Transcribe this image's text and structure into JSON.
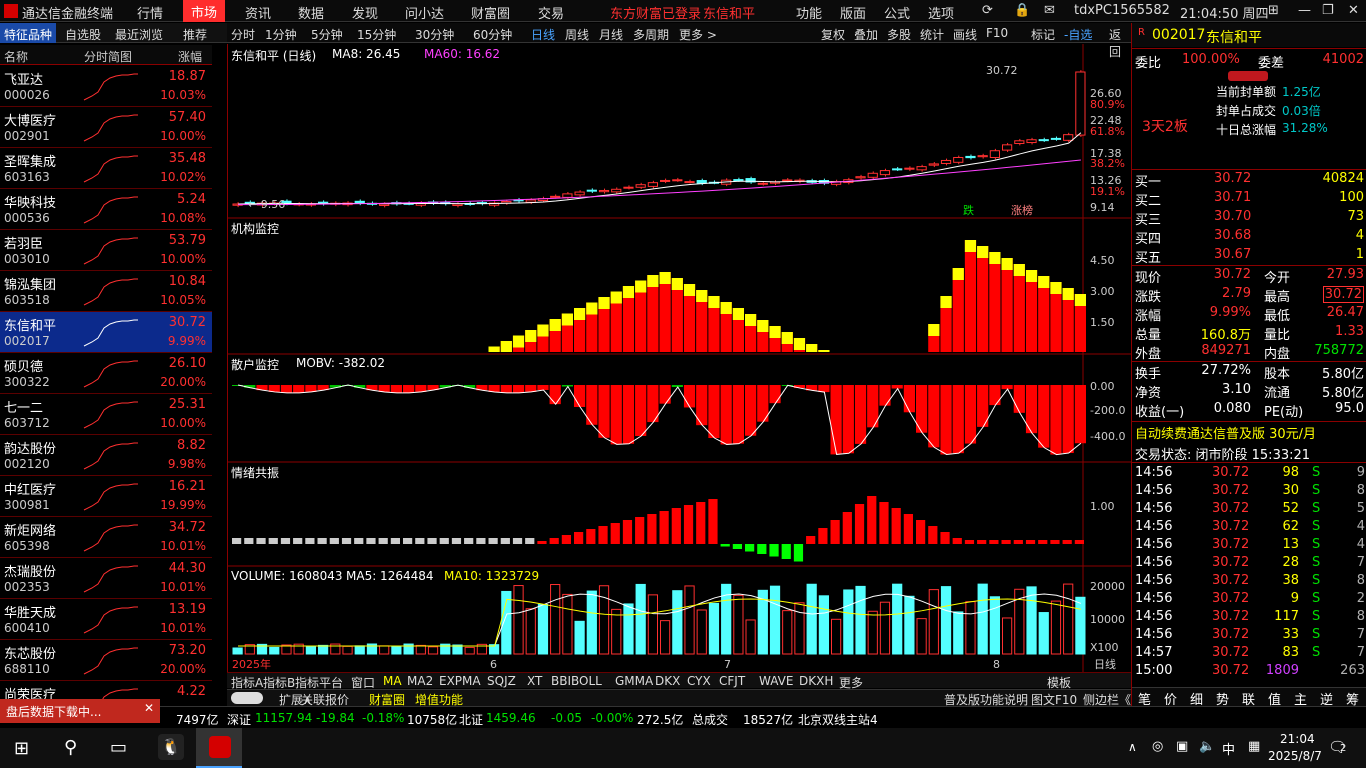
{
  "app": {
    "title": "通达信金融终端",
    "connection_notice": "东方财富已登录",
    "stock_notice": "东信和平",
    "pc_id": "tdxPC1565582",
    "clock": "21:04:50 周四"
  },
  "menu": [
    "行情",
    "市场",
    "资讯",
    "数据",
    "发现",
    "问小达",
    "财富圈",
    "交易"
  ],
  "menu_active": "市场",
  "menu_right": [
    "功能",
    "版面",
    "公式",
    "选项"
  ],
  "left_tabs": [
    "特征品种",
    "自选股",
    "最近浏览",
    "推荐"
  ],
  "list_headers": {
    "name": "名称",
    "chart": "分时简图",
    "change": "涨幅"
  },
  "stocks": [
    {
      "name": "飞亚达",
      "code": "000026",
      "price": "18.87",
      "pct": "10.03%"
    },
    {
      "name": "大博医疗",
      "code": "002901",
      "price": "57.40",
      "pct": "10.00%"
    },
    {
      "name": "圣晖集成",
      "code": "603163",
      "price": "35.48",
      "pct": "10.02%"
    },
    {
      "name": "华映科技",
      "code": "000536",
      "price": "5.24",
      "pct": "10.08%"
    },
    {
      "name": "若羽臣",
      "code": "003010",
      "price": "53.79",
      "pct": "10.00%"
    },
    {
      "name": "锦泓集团",
      "code": "603518",
      "price": "10.84",
      "pct": "10.05%"
    },
    {
      "name": "东信和平",
      "code": "002017",
      "price": "30.72",
      "pct": "9.99%"
    },
    {
      "name": "硕贝德",
      "code": "300322",
      "price": "26.10",
      "pct": "20.00%"
    },
    {
      "name": "七一二",
      "code": "603712",
      "price": "25.31",
      "pct": "10.00%"
    },
    {
      "name": "韵达股份",
      "code": "002120",
      "price": "8.82",
      "pct": "9.98%"
    },
    {
      "name": "中红医疗",
      "code": "300981",
      "price": "16.21",
      "pct": "19.99%"
    },
    {
      "name": "新炬网络",
      "code": "605398",
      "price": "34.72",
      "pct": "10.01%"
    },
    {
      "name": "杰瑞股份",
      "code": "002353",
      "price": "44.30",
      "pct": "10.01%"
    },
    {
      "name": "华胜天成",
      "code": "600410",
      "price": "13.19",
      "pct": "10.01%"
    },
    {
      "name": "东芯股份",
      "code": "688110",
      "price": "73.20",
      "pct": "20.00%"
    },
    {
      "name": "尚荣医疗",
      "code": "",
      "price": "4.22",
      "pct": ""
    }
  ],
  "chart_toolbar": [
    "分时",
    "1分钟",
    "5分钟",
    "15分钟",
    "30分钟",
    "60分钟",
    "日线",
    "周线",
    "月线",
    "多周期",
    "更多 >"
  ],
  "chart_toolbar_active": "日线",
  "chart_toolbar_right": [
    "复权",
    "叠加",
    "多股",
    "统计",
    "画线",
    "F10",
    "标记",
    "-自选",
    "返回"
  ],
  "panels": {
    "k": {
      "title": "东信和平 (日线)",
      "ma8": "MA8: 26.45",
      "ma60": "MA60: 16.62",
      "high_label": "30.72",
      "low_label": "9.56",
      "axis": [
        "26.60",
        "80.9%",
        "22.48",
        "61.8%",
        "17.38",
        "38.2%",
        "13.26",
        "19.1%",
        "9.14"
      ],
      "marks": [
        "跌",
        "涨榜"
      ]
    },
    "inst": {
      "title": "机构监控",
      "axis": [
        "4.50",
        "3.00",
        "1.50"
      ]
    },
    "retail": {
      "title": "散户监控",
      "value": "MOBV: -382.02",
      "axis": [
        "0.00",
        "-200.0",
        "-400.0"
      ]
    },
    "mood": {
      "title": "情绪共振",
      "axis": [
        "1.00"
      ]
    },
    "vol": {
      "title": "VOLUME: 1608043",
      "ma5": "MA5: 1264484",
      "ma10": "MA10: 1323729",
      "axis": [
        "20000",
        "10000",
        "X100"
      ]
    }
  },
  "time_axis": [
    "2025年",
    "6",
    "7",
    "8",
    "日线"
  ],
  "bottom_tabs": [
    "指标A",
    "指标B",
    "指标平台",
    "窗口",
    "MA",
    "MA2",
    "EXPMA",
    "SQJZ",
    "XT",
    "BBIBOLL",
    "GMMA",
    "DKX",
    "CYX",
    "CFJT",
    "WAVE",
    "DKXH",
    "更多",
    "模板"
  ],
  "bottom_tabs2": [
    "扩展∧",
    "关联报价",
    "财富圈",
    "增值功能",
    "普及版功能说明",
    "图文F10",
    "侧边栏《"
  ],
  "quote": {
    "code": "002017",
    "name": "东信和平",
    "weibi_label": "委比",
    "weibi": "100.00%",
    "weicha_label": "委差",
    "weicha": "41002",
    "seal_labels": [
      "当前封单额",
      "封单占成交",
      "十日总涨幅"
    ],
    "seal_values": [
      "1.25亿",
      "0.03倍",
      "31.28%"
    ],
    "streak": "3天2板",
    "book": [
      {
        "label": "买一",
        "price": "30.72",
        "vol": "40824"
      },
      {
        "label": "买二",
        "price": "30.71",
        "vol": "100"
      },
      {
        "label": "买三",
        "price": "30.70",
        "vol": "73"
      },
      {
        "label": "买四",
        "price": "30.68",
        "vol": "4"
      },
      {
        "label": "买五",
        "price": "30.67",
        "vol": "1"
      }
    ],
    "stats": [
      [
        "现价",
        "30.72",
        "今开",
        "27.93"
      ],
      [
        "涨跌",
        "2.79",
        "最高",
        "30.72"
      ],
      [
        "涨幅",
        "9.99%",
        "最低",
        "26.47"
      ],
      [
        "总量",
        "160.8万",
        "量比",
        "1.33"
      ],
      [
        "外盘",
        "849271",
        "内盘",
        "758772"
      ]
    ],
    "stats2": [
      [
        "换手",
        "27.72%",
        "股本",
        "5.80亿"
      ],
      [
        "净资",
        "3.10",
        "流通",
        "5.80亿"
      ],
      [
        "收益(一)",
        "0.080",
        "PE(动)",
        "95.0"
      ]
    ],
    "promo": "自动续费通达信普及版 30元/月",
    "trade_state": "交易状态: 闭市阶段 15:33:21",
    "ticks": [
      [
        "14:56",
        "30.72",
        "98",
        "S",
        "9"
      ],
      [
        "14:56",
        "30.72",
        "30",
        "S",
        "8"
      ],
      [
        "14:56",
        "30.72",
        "52",
        "S",
        "5"
      ],
      [
        "14:56",
        "30.72",
        "62",
        "S",
        "4"
      ],
      [
        "14:56",
        "30.72",
        "13",
        "S",
        "4"
      ],
      [
        "14:56",
        "30.72",
        "28",
        "S",
        "7"
      ],
      [
        "14:56",
        "30.72",
        "38",
        "S",
        "8"
      ],
      [
        "14:56",
        "30.72",
        "9",
        "S",
        "2"
      ],
      [
        "14:56",
        "30.72",
        "117",
        "S",
        "8"
      ],
      [
        "14:56",
        "30.72",
        "33",
        "S",
        "7"
      ],
      [
        "14:57",
        "30.72",
        "83",
        "S",
        "7"
      ],
      [
        "15:00",
        "30.72",
        "1809",
        "",
        "263"
      ]
    ],
    "right_tabs": [
      "笔",
      "价",
      "细",
      "势",
      "联",
      "值",
      "主",
      "逆",
      "筹"
    ]
  },
  "status": {
    "a": "7497亿",
    "sz_label": "深证",
    "sz": "11157.94",
    "sz_chg": "-19.84",
    "sz_pct": "-0.18%",
    "sz_amt": "10758亿",
    "bz_label": "北证",
    "bz": "1459.46",
    "bz_chg": "-0.05",
    "bz_pct": "-0.00%",
    "bz_amt": "272.5亿",
    "total_label": "总成交",
    "total": "18527亿",
    "server": "北京双线主站4"
  },
  "download_msg": "盘后数据下载中...",
  "taskbar": {
    "time": "21:04",
    "date": "2025/8/7",
    "ime": "中",
    "notif": "2"
  }
}
